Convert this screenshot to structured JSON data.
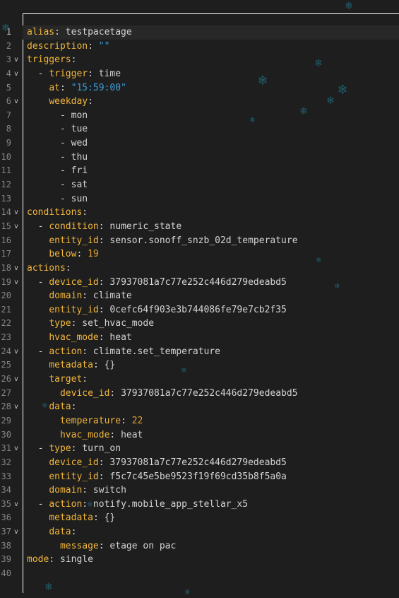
{
  "editor": {
    "active_line": 1,
    "lines": [
      {
        "num": "1",
        "fold": "",
        "parts": [
          {
            "t": "k",
            "x": "alias"
          },
          {
            "t": "v",
            "x": ": testpacetage"
          }
        ]
      },
      {
        "num": "2",
        "fold": "",
        "parts": [
          {
            "t": "k",
            "x": "description"
          },
          {
            "t": "v",
            "x": ": "
          },
          {
            "t": "s",
            "x": "\"\""
          }
        ]
      },
      {
        "num": "3",
        "fold": "v",
        "parts": [
          {
            "t": "k",
            "x": "triggers"
          },
          {
            "t": "v",
            "x": ":"
          }
        ]
      },
      {
        "num": "4",
        "fold": "v",
        "parts": [
          {
            "t": "v",
            "x": "  - "
          },
          {
            "t": "k",
            "x": "trigger"
          },
          {
            "t": "v",
            "x": ": time"
          }
        ]
      },
      {
        "num": "5",
        "fold": "",
        "parts": [
          {
            "t": "v",
            "x": "    "
          },
          {
            "t": "k",
            "x": "at"
          },
          {
            "t": "v",
            "x": ": "
          },
          {
            "t": "s",
            "x": "\"15:59:00\""
          }
        ]
      },
      {
        "num": "6",
        "fold": "v",
        "parts": [
          {
            "t": "v",
            "x": "    "
          },
          {
            "t": "k",
            "x": "weekday"
          },
          {
            "t": "v",
            "x": ":"
          }
        ]
      },
      {
        "num": "7",
        "fold": "",
        "parts": [
          {
            "t": "v",
            "x": "      - mon"
          }
        ]
      },
      {
        "num": "8",
        "fold": "",
        "parts": [
          {
            "t": "v",
            "x": "      - tue"
          }
        ]
      },
      {
        "num": "9",
        "fold": "",
        "parts": [
          {
            "t": "v",
            "x": "      - wed"
          }
        ]
      },
      {
        "num": "10",
        "fold": "",
        "parts": [
          {
            "t": "v",
            "x": "      - thu"
          }
        ]
      },
      {
        "num": "11",
        "fold": "",
        "parts": [
          {
            "t": "v",
            "x": "      - fri"
          }
        ]
      },
      {
        "num": "12",
        "fold": "",
        "parts": [
          {
            "t": "v",
            "x": "      - sat"
          }
        ]
      },
      {
        "num": "13",
        "fold": "",
        "parts": [
          {
            "t": "v",
            "x": "      - sun"
          }
        ]
      },
      {
        "num": "14",
        "fold": "v",
        "parts": [
          {
            "t": "k",
            "x": "conditions"
          },
          {
            "t": "v",
            "x": ":"
          }
        ]
      },
      {
        "num": "15",
        "fold": "v",
        "parts": [
          {
            "t": "v",
            "x": "  - "
          },
          {
            "t": "k",
            "x": "condition"
          },
          {
            "t": "v",
            "x": ": numeric_state"
          }
        ]
      },
      {
        "num": "16",
        "fold": "",
        "parts": [
          {
            "t": "v",
            "x": "    "
          },
          {
            "t": "k",
            "x": "entity_id"
          },
          {
            "t": "v",
            "x": ": sensor.sonoff_snzb_02d_temperature"
          }
        ]
      },
      {
        "num": "17",
        "fold": "",
        "parts": [
          {
            "t": "v",
            "x": "    "
          },
          {
            "t": "k",
            "x": "below"
          },
          {
            "t": "v",
            "x": ": "
          },
          {
            "t": "n",
            "x": "19"
          }
        ]
      },
      {
        "num": "18",
        "fold": "v",
        "parts": [
          {
            "t": "k",
            "x": "actions"
          },
          {
            "t": "v",
            "x": ":"
          }
        ]
      },
      {
        "num": "19",
        "fold": "v",
        "parts": [
          {
            "t": "v",
            "x": "  - "
          },
          {
            "t": "k",
            "x": "device_id"
          },
          {
            "t": "v",
            "x": ": 37937081a7c77e252c446d279edeabd5"
          }
        ]
      },
      {
        "num": "20",
        "fold": "",
        "parts": [
          {
            "t": "v",
            "x": "    "
          },
          {
            "t": "k",
            "x": "domain"
          },
          {
            "t": "v",
            "x": ": climate"
          }
        ]
      },
      {
        "num": "21",
        "fold": "",
        "parts": [
          {
            "t": "v",
            "x": "    "
          },
          {
            "t": "k",
            "x": "entity_id"
          },
          {
            "t": "v",
            "x": ": 0cefc64f903e3b744086fe79e7cb2f35"
          }
        ]
      },
      {
        "num": "22",
        "fold": "",
        "parts": [
          {
            "t": "v",
            "x": "    "
          },
          {
            "t": "k",
            "x": "type"
          },
          {
            "t": "v",
            "x": ": set_hvac_mode"
          }
        ]
      },
      {
        "num": "23",
        "fold": "",
        "parts": [
          {
            "t": "v",
            "x": "    "
          },
          {
            "t": "k",
            "x": "hvac_mode"
          },
          {
            "t": "v",
            "x": ": heat"
          }
        ]
      },
      {
        "num": "24",
        "fold": "v",
        "parts": [
          {
            "t": "v",
            "x": "  - "
          },
          {
            "t": "k",
            "x": "action"
          },
          {
            "t": "v",
            "x": ": climate.set_temperature"
          }
        ]
      },
      {
        "num": "25",
        "fold": "",
        "parts": [
          {
            "t": "v",
            "x": "    "
          },
          {
            "t": "k",
            "x": "metadata"
          },
          {
            "t": "v",
            "x": ": {}"
          }
        ]
      },
      {
        "num": "26",
        "fold": "v",
        "parts": [
          {
            "t": "v",
            "x": "    "
          },
          {
            "t": "k",
            "x": "target"
          },
          {
            "t": "v",
            "x": ":"
          }
        ]
      },
      {
        "num": "27",
        "fold": "",
        "parts": [
          {
            "t": "v",
            "x": "      "
          },
          {
            "t": "k",
            "x": "device_id"
          },
          {
            "t": "v",
            "x": ": 37937081a7c77e252c446d279edeabd5"
          }
        ]
      },
      {
        "num": "28",
        "fold": "v",
        "parts": [
          {
            "t": "v",
            "x": "    "
          },
          {
            "t": "k",
            "x": "data"
          },
          {
            "t": "v",
            "x": ":"
          }
        ]
      },
      {
        "num": "29",
        "fold": "",
        "parts": [
          {
            "t": "v",
            "x": "      "
          },
          {
            "t": "k",
            "x": "temperature"
          },
          {
            "t": "v",
            "x": ": "
          },
          {
            "t": "n",
            "x": "22"
          }
        ]
      },
      {
        "num": "30",
        "fold": "",
        "parts": [
          {
            "t": "v",
            "x": "      "
          },
          {
            "t": "k",
            "x": "hvac_mode"
          },
          {
            "t": "v",
            "x": ": heat"
          }
        ]
      },
      {
        "num": "31",
        "fold": "v",
        "parts": [
          {
            "t": "v",
            "x": "  - "
          },
          {
            "t": "k",
            "x": "type"
          },
          {
            "t": "v",
            "x": ": turn_on"
          }
        ]
      },
      {
        "num": "32",
        "fold": "",
        "parts": [
          {
            "t": "v",
            "x": "    "
          },
          {
            "t": "k",
            "x": "device_id"
          },
          {
            "t": "v",
            "x": ": 37937081a7c77e252c446d279edeabd5"
          }
        ]
      },
      {
        "num": "33",
        "fold": "",
        "parts": [
          {
            "t": "v",
            "x": "    "
          },
          {
            "t": "k",
            "x": "entity_id"
          },
          {
            "t": "v",
            "x": ": f5c7c45e5be9523f19f69cd35b8f5a0a"
          }
        ]
      },
      {
        "num": "34",
        "fold": "",
        "parts": [
          {
            "t": "v",
            "x": "    "
          },
          {
            "t": "k",
            "x": "domain"
          },
          {
            "t": "v",
            "x": ": switch"
          }
        ]
      },
      {
        "num": "35",
        "fold": "v",
        "parts": [
          {
            "t": "v",
            "x": "  - "
          },
          {
            "t": "k",
            "x": "action"
          },
          {
            "t": "v",
            "x": ": notify.mobile_app_stellar_x5"
          }
        ]
      },
      {
        "num": "36",
        "fold": "",
        "parts": [
          {
            "t": "v",
            "x": "    "
          },
          {
            "t": "k",
            "x": "metadata"
          },
          {
            "t": "v",
            "x": ": {}"
          }
        ]
      },
      {
        "num": "37",
        "fold": "v",
        "parts": [
          {
            "t": "v",
            "x": "    "
          },
          {
            "t": "k",
            "x": "data"
          },
          {
            "t": "v",
            "x": ":"
          }
        ]
      },
      {
        "num": "38",
        "fold": "",
        "parts": [
          {
            "t": "v",
            "x": "      "
          },
          {
            "t": "k",
            "x": "message"
          },
          {
            "t": "v",
            "x": ": etage on pac"
          }
        ]
      },
      {
        "num": "39",
        "fold": "",
        "parts": [
          {
            "t": "k",
            "x": "mode"
          },
          {
            "t": "v",
            "x": ": single"
          }
        ]
      },
      {
        "num": "40",
        "fold": "",
        "parts": []
      }
    ]
  },
  "colors": {
    "background": "#1e1e1e",
    "key": "#f3b73c",
    "string": "#3c9cd8",
    "number": "#e0a030",
    "text": "#d4d4d4",
    "snowflake": "#1f5e6a"
  },
  "decorations": {
    "snowflake_glyph": "❄",
    "snowflake_icon": "snowflake-icon",
    "fold_icon": "chevron-down-icon"
  }
}
